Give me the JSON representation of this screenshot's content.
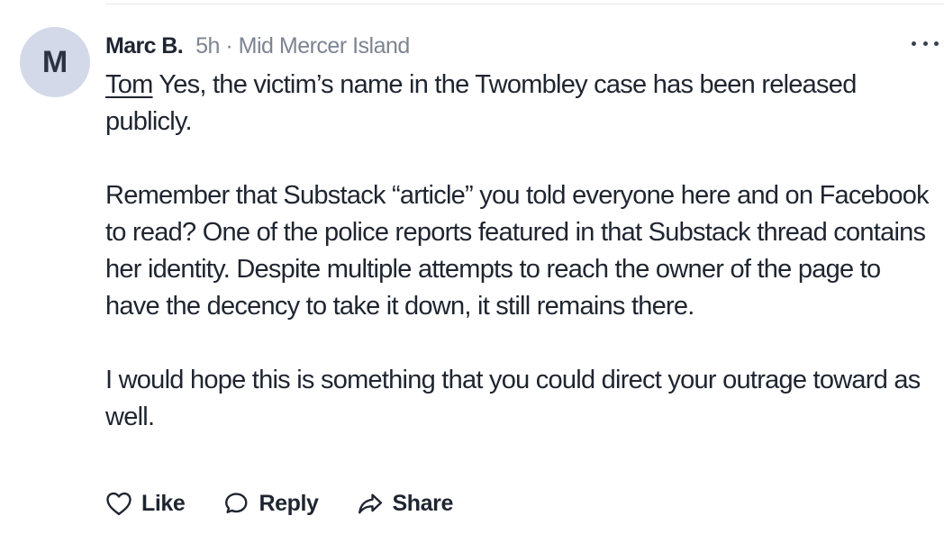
{
  "comment": {
    "author": "Marc B.",
    "avatar_initial": "M",
    "meta": "5h · Mid Mercer Island",
    "mention": "Tom",
    "paragraph1_rest": " Yes, the victim’s name in the Twombley case has been released publicly.",
    "paragraph2": "Remember that Substack “article” you told everyone here and on Facebook to read? One of the police reports featured in that Substack thread contains her identity. Despite multiple attempts to reach the owner of the page to have the decency to take it down, it still remains there.",
    "paragraph3": "I would hope this is something that you could direct your outrage toward as well."
  },
  "actions": {
    "like_label": "Like",
    "reply_label": "Reply",
    "share_label": "Share"
  },
  "icons": {
    "more": "more-horizontal-icon",
    "like": "heart-icon",
    "reply": "speech-bubble-icon",
    "share": "share-arrow-icon"
  },
  "colors": {
    "avatar_bg": "#d3d9e8",
    "text": "#1f2530",
    "meta_text": "#7d8491",
    "divider": "#e6e8ec"
  }
}
